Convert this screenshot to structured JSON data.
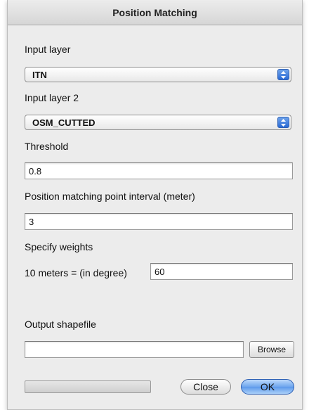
{
  "window": {
    "title": "Position Matching"
  },
  "input_layer": {
    "label": "Input layer",
    "selected": "ITN"
  },
  "input_layer_2": {
    "label": "Input  layer 2",
    "selected": "OSM_CUTTED"
  },
  "threshold": {
    "label": "Threshold",
    "value": "0.8"
  },
  "interval": {
    "label": "Position matching point interval (meter)",
    "value": "3"
  },
  "weights": {
    "label": "Specify weights",
    "row_label": "10 meters = (in degree)",
    "value": "60"
  },
  "output": {
    "label": "Output shapefile",
    "value": "",
    "browse_label": "Browse"
  },
  "progress": {
    "value": 0
  },
  "buttons": {
    "close_label": "Close",
    "ok_label": "OK"
  },
  "colors": {
    "accent": "#5d99eb",
    "window_bg": "#ececec"
  },
  "icons": {
    "select_arrows": "updown-arrows-icon"
  }
}
